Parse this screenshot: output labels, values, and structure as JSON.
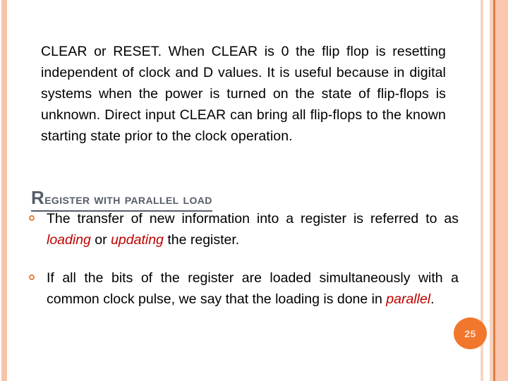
{
  "slide": {
    "page_number": "25",
    "intro_paragraph": "CLEAR or RESET. When CLEAR is 0 the flip flop is resetting independent of clock and D values. It is useful because in digital systems when the power is turned on the state of flip-flops is unknown. Direct input CLEAR can bring all flip-flops to the known starting state prior to the clock operation.",
    "section_heading": "Register with parallel load",
    "bullets": [
      {
        "segments": [
          {
            "text": "The transfer of new information into a register is referred to as ",
            "style": "normal"
          },
          {
            "text": "loading",
            "style": "emphasis-red-italic"
          },
          {
            "text": " or ",
            "style": "normal"
          },
          {
            "text": "updating",
            "style": "emphasis-red-italic"
          },
          {
            "text": " the register.",
            "style": "normal"
          }
        ]
      },
      {
        "segments": [
          {
            "text": "If all the bits of the register are loaded simultaneously with a common clock pulse, we say that the loading is done in ",
            "style": "normal"
          },
          {
            "text": "parallel",
            "style": "emphasis-red-italic"
          },
          {
            "text": ".",
            "style": "normal"
          }
        ]
      }
    ]
  },
  "theme": {
    "accent_orange": "#e8833a",
    "badge_fill": "#f1772c",
    "badge_text": "#fbe4d2",
    "heading_color": "#565c69",
    "emphasis_color": "#c00000",
    "stripe_peach": "#f7c4ab",
    "stripe_light": "#f6d6c6",
    "stripe_dark": "#e0803f",
    "background": "#ffffff"
  }
}
